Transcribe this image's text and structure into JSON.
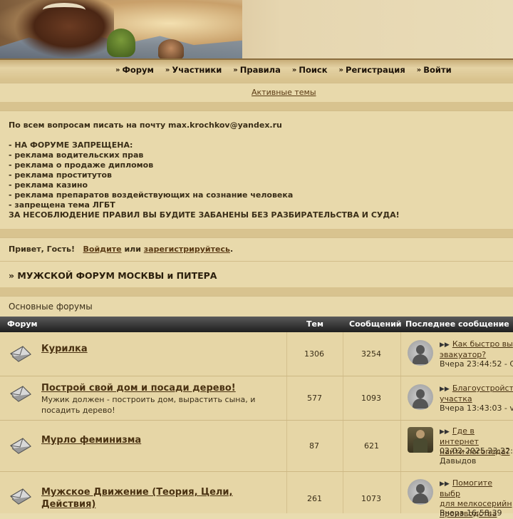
{
  "nav": {
    "items": [
      "Форум",
      "Участники",
      "Правила",
      "Поиск",
      "Регистрация",
      "Войти"
    ]
  },
  "active_topics": "Активные темы",
  "notice": {
    "contact": "По всем вопросам писать на почту max.krochkov@yandex.ru",
    "header": "- НА ФОРУМЕ ЗАПРЕЩЕНА:",
    "rules": [
      "- реклама водительских прав",
      "- реклама о продаже дипломов",
      "- реклама проститутов",
      "- реклама казино",
      "- реклама препаратов воздействующих на сознание человека",
      "- запрещена тема ЛГБТ"
    ],
    "warning": "ЗА НЕСОБЛЮДЕНИЕ ПРАВИЛ ВЫ БУДИТЕ ЗАБАНЕНЫ БЕЗ РАЗБИРАТЕЛЬСТВА И СУДА!"
  },
  "greeting": {
    "hello": "Привет, Гость!",
    "login": "Войдите",
    "or": "или",
    "register": "зарегистрируйтесь",
    "dot": "."
  },
  "forum_title": "» МУЖСКОЙ ФОРУМ МОСКВЫ и ПИТЕРА",
  "section_title": "Основные форумы",
  "table": {
    "headers": {
      "forum": "Форум",
      "topics": "Тем",
      "posts": "Сообщений",
      "last": "Последнее сообщение"
    },
    "rows": [
      {
        "title": "Курилка",
        "desc": "",
        "topics": "1306",
        "posts": "3254",
        "last_link": [
          "Как быстро вы",
          "эвакуатор?"
        ],
        "last_meta": [
          "Вчера 23:44:52 - С"
        ]
      },
      {
        "title": "Построй свой дом и посади дерево!",
        "desc": "Мужик должен - построить дом, вырастить сына, и посадить дерево!",
        "topics": "577",
        "posts": "1093",
        "last_link": [
          "Благоустройст",
          "участка"
        ],
        "last_meta": [
          "Вчера 13:43:03 - v"
        ]
      },
      {
        "title": "Мурло феминизма",
        "desc": "",
        "topics": "87",
        "posts": "621",
        "last_link": [
          "Где в интернет",
          "найти логопеда?"
        ],
        "last_meta": [
          "02-02-2025 23:22:",
          "Давыдов"
        ]
      },
      {
        "title": "Мужское Движение (Теория, Цели, Действия)",
        "desc": "",
        "topics": "261",
        "posts": "1073",
        "last_link": [
          "Помогите выбр",
          "для мелкосерийн",
          "производства"
        ],
        "last_meta": [
          "Вчера 16:58:39"
        ]
      }
    ]
  }
}
